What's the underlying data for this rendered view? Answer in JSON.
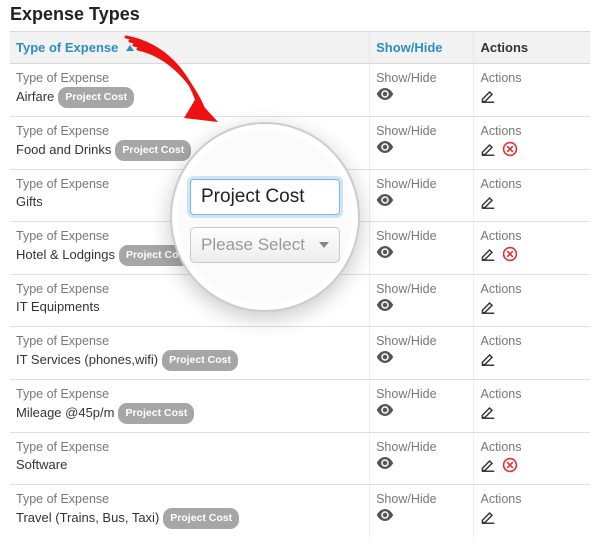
{
  "title": "Expense Types",
  "headers": {
    "type": "Type of Expense",
    "show": "Show/Hide",
    "actions": "Actions"
  },
  "row_labels": {
    "type": "Type of Expense",
    "show": "Show/Hide",
    "actions": "Actions"
  },
  "badge_label": "Project Cost",
  "callout": {
    "input_value": "Project Cost",
    "select_placeholder": "Please Select"
  },
  "rows": [
    {
      "name": "Airfare",
      "project_cost": true,
      "delete": false
    },
    {
      "name": "Food and Drinks",
      "project_cost": true,
      "delete": true
    },
    {
      "name": "Gifts",
      "project_cost": false,
      "delete": false
    },
    {
      "name": "Hotel & Lodgings",
      "project_cost": true,
      "delete": true
    },
    {
      "name": "IT Equipments",
      "project_cost": false,
      "delete": false
    },
    {
      "name": "IT Services (phones,wifi)",
      "project_cost": true,
      "delete": false
    },
    {
      "name": "Mileage @45p/m",
      "project_cost": true,
      "delete": false
    },
    {
      "name": "Software",
      "project_cost": false,
      "delete": true
    },
    {
      "name": "Travel (Trains, Bus, Taxi)",
      "project_cost": true,
      "delete": false
    }
  ]
}
